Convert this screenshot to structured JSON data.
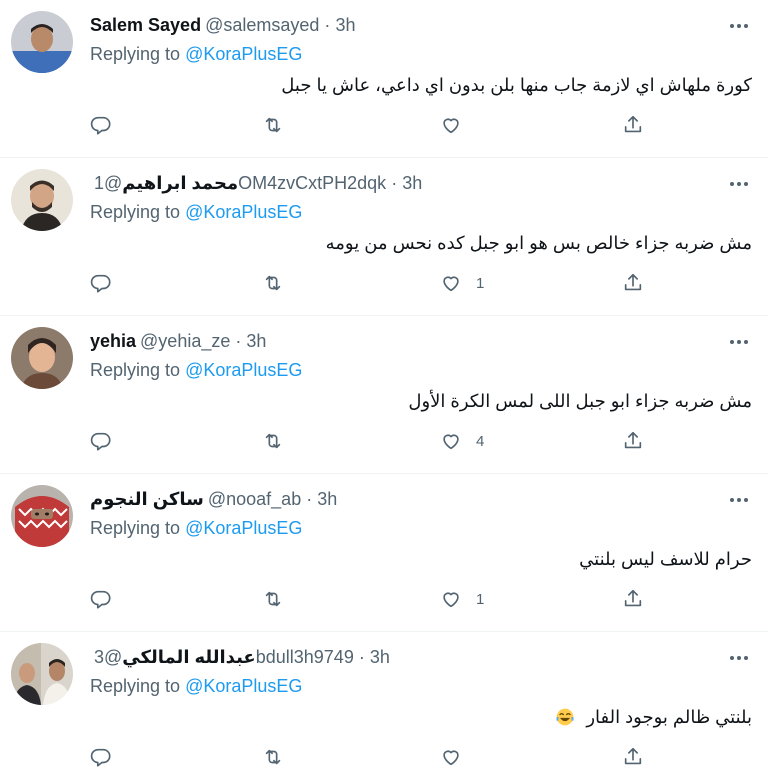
{
  "replying_label": "Replying to ",
  "tweets": [
    {
      "name": "Salem Sayed",
      "handle": "@salemsayed",
      "separator": "·",
      "time": "3h",
      "mention": "@KoraPlusEG",
      "text": "كورة ملهاش اي لازمة جاب منها بلن بدون اي داعي، عاش يا جبل",
      "likes": ""
    },
    {
      "name": "محمد ابراهيم",
      "handle": "@1OM4zvCxtPH2dqk",
      "separator": "·",
      "time": "3h",
      "mention": "@KoraPlusEG",
      "text": "مش ضربه جزاء خالص بس هو ابو جبل كده نحس من يومه",
      "likes": "1"
    },
    {
      "name": "yehia",
      "handle": "@yehia_ze",
      "separator": "·",
      "time": "3h",
      "mention": "@KoraPlusEG",
      "text": "مش ضربه جزاء  ابو جبل اللى لمس الكرة الأول",
      "likes": "4"
    },
    {
      "name": "ساكن النجوم",
      "handle": "@nooaf_ab",
      "separator": "·",
      "time": "3h",
      "mention": "@KoraPlusEG",
      "text": "حرام للاسف ليس بلنتي",
      "likes": "1"
    },
    {
      "name": "عبدالله المالكي",
      "handle": "@3bdull3h9749",
      "separator": "·",
      "time": "3h",
      "mention": "@KoraPlusEG",
      "text": "بلنتي ظالم بوجود الفار",
      "emoji": "face-with-tears-of-joy",
      "likes": ""
    }
  ],
  "icons": {
    "reply": "reply-icon",
    "retweet": "retweet-icon",
    "like": "like-icon",
    "share": "share-icon",
    "more": "more-icon"
  },
  "colors": {
    "mention": "#1d9bf0",
    "secondary_text": "#536471",
    "primary_text": "#0f1419"
  }
}
